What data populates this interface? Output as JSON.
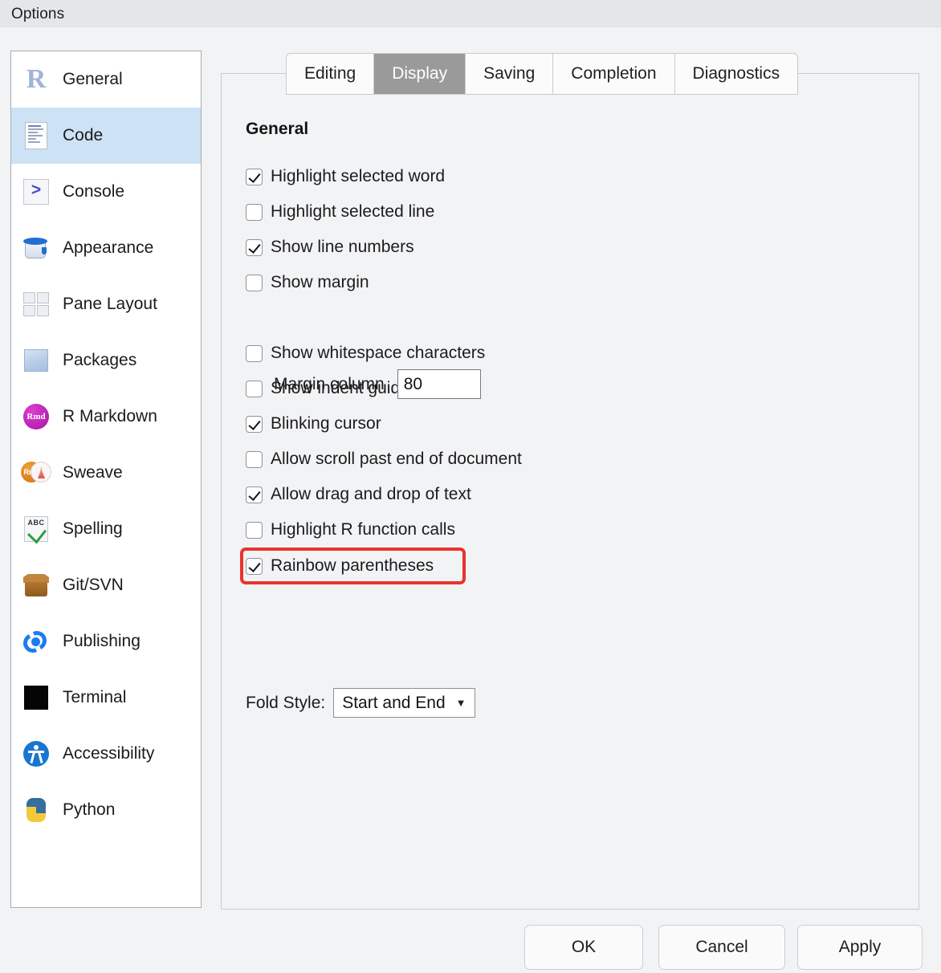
{
  "window": {
    "title": "Options"
  },
  "sidebar": {
    "items": [
      {
        "label": "General",
        "icon": "r-logo-icon",
        "selected": false
      },
      {
        "label": "Code",
        "icon": "code-document-icon",
        "selected": true
      },
      {
        "label": "Console",
        "icon": "console-prompt-icon",
        "selected": false
      },
      {
        "label": "Appearance",
        "icon": "paint-can-icon",
        "selected": false
      },
      {
        "label": "Pane Layout",
        "icon": "pane-grid-icon",
        "selected": false
      },
      {
        "label": "Packages",
        "icon": "package-cube-icon",
        "selected": false
      },
      {
        "label": "R Markdown",
        "icon": "rmd-circle-icon",
        "selected": false
      },
      {
        "label": "Sweave",
        "icon": "sweave-pdf-icon",
        "selected": false
      },
      {
        "label": "Spelling",
        "icon": "abc-check-icon",
        "selected": false
      },
      {
        "label": "Git/SVN",
        "icon": "open-box-icon",
        "selected": false
      },
      {
        "label": "Publishing",
        "icon": "publish-orbit-icon",
        "selected": false
      },
      {
        "label": "Terminal",
        "icon": "terminal-square-icon",
        "selected": false
      },
      {
        "label": "Accessibility",
        "icon": "accessibility-icon",
        "selected": false
      },
      {
        "label": "Python",
        "icon": "python-logo-icon",
        "selected": false
      }
    ]
  },
  "tabs": [
    {
      "label": "Editing",
      "selected": false
    },
    {
      "label": "Display",
      "selected": true
    },
    {
      "label": "Saving",
      "selected": false
    },
    {
      "label": "Completion",
      "selected": false
    },
    {
      "label": "Diagnostics",
      "selected": false
    }
  ],
  "panel": {
    "section_title": "General",
    "checkboxes": [
      {
        "label": "Highlight selected word",
        "checked": true,
        "flagged": false
      },
      {
        "label": "Highlight selected line",
        "checked": false,
        "flagged": false
      },
      {
        "label": "Show line numbers",
        "checked": true,
        "flagged": false
      },
      {
        "label": "Show margin",
        "checked": false,
        "flagged": false
      },
      {
        "label": "Show whitespace characters",
        "checked": false,
        "flagged": false
      },
      {
        "label": "Show indent guides",
        "checked": false,
        "flagged": false
      },
      {
        "label": "Blinking cursor",
        "checked": true,
        "flagged": false
      },
      {
        "label": "Allow scroll past end of document",
        "checked": false,
        "flagged": false
      },
      {
        "label": "Allow drag and drop of text",
        "checked": true,
        "flagged": false
      },
      {
        "label": "Highlight R function calls",
        "checked": false,
        "flagged": false
      },
      {
        "label": "Rainbow parentheses",
        "checked": true,
        "flagged": true
      }
    ],
    "margin_column": {
      "label": "Margin column",
      "value": "80"
    },
    "fold_style": {
      "label": "Fold Style:",
      "value": "Start and End",
      "arrow": "▼"
    }
  },
  "footer": {
    "ok": "OK",
    "cancel": "Cancel",
    "apply": "Apply"
  },
  "colors": {
    "selection_blue": "#cde2f5",
    "tab_selected_gray": "#9a9a9a",
    "annotation_red": "#e8342c",
    "dialog_background": "#f2f3f5",
    "titlebar_background": "#e4e7ea"
  }
}
